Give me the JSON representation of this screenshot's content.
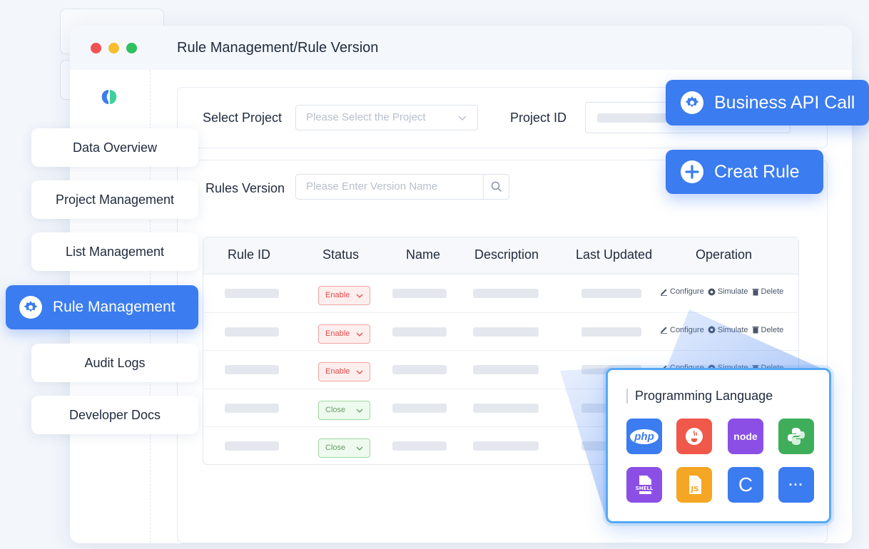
{
  "window": {
    "title": "Rule Management/Rule Version"
  },
  "filters": {
    "select_project_label": "Select Project",
    "select_project_placeholder": "Please Select the Project",
    "project_id_label": "Project ID",
    "rules_version_label": "Rules Version",
    "rules_version_placeholder": "Please Enter Version Name"
  },
  "table": {
    "headers": [
      "Rule ID",
      "Status",
      "Name",
      "Description",
      "Last Updated",
      "Operation"
    ],
    "rows": [
      {
        "status": "Enable",
        "status_kind": "enable"
      },
      {
        "status": "Enable",
        "status_kind": "enable"
      },
      {
        "status": "Enable",
        "status_kind": "enable"
      },
      {
        "status": "Close",
        "status_kind": "close"
      },
      {
        "status": "Close",
        "status_kind": "close"
      }
    ],
    "operations": {
      "configure": "Configure",
      "simulate": "Simulate",
      "delete": "Delete"
    }
  },
  "nav": {
    "items": [
      {
        "label": "Data Overview"
      },
      {
        "label": "Project Management"
      },
      {
        "label": "List Management"
      },
      {
        "label": "Rule Management",
        "active": true
      },
      {
        "label": "Audit Logs"
      },
      {
        "label": "Developer Docs"
      }
    ]
  },
  "actions": {
    "business_api_call": "Business API Call",
    "create_rule": "Creat Rule"
  },
  "languages": {
    "title": "Programming Language",
    "items": [
      {
        "name": "php-icon",
        "label": "php",
        "color": "#3b7cf0"
      },
      {
        "name": "java-icon",
        "label": "",
        "color": "#f0584a"
      },
      {
        "name": "node-icon",
        "label": "node",
        "color": "#8b4fe6"
      },
      {
        "name": "python-icon",
        "label": "",
        "color": "#3fae5a"
      },
      {
        "name": "shell-icon",
        "label": "SHELL",
        "color": "#8b4fe6"
      },
      {
        "name": "js-icon",
        "label": "JS",
        "color": "#f5a623"
      },
      {
        "name": "c-icon",
        "label": "C",
        "color": "#3b7cf0"
      },
      {
        "name": "more-icon",
        "label": "···",
        "color": "#3b7cf0"
      }
    ]
  },
  "colors": {
    "accent": "#3b7cf0",
    "enable": "#e04a4a",
    "close": "#6a9a6a"
  }
}
